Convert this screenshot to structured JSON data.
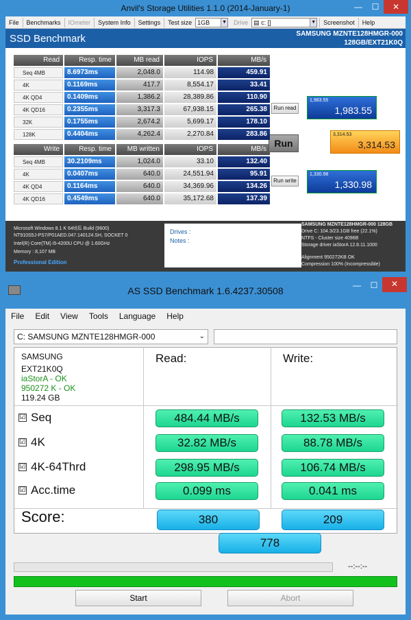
{
  "anvil": {
    "title": "Anvil's Storage Utilities 1.1.0 (2014-January-1)",
    "menu": [
      "File",
      "Benchmarks",
      "IOmeter",
      "System Info",
      "Settings"
    ],
    "testsize_label": "Test size",
    "testsize_value": "1GB",
    "drive_label": "Drive",
    "drive_value": "c: []",
    "screenshot_label": "Screenshot",
    "help_label": "Help",
    "header": "SSD Benchmark",
    "device_line1": "SAMSUNG MZNTE128HMGR-000",
    "device_line2": "128GB/EXT21K0Q",
    "read_headers": [
      "Read",
      "Resp. time",
      "MB read",
      "IOPS",
      "MB/s"
    ],
    "read_rows": [
      {
        "label": "Seq 4MB",
        "resp": "8.6973ms",
        "mb": "2,048.0",
        "iops": "114.98",
        "mbs": "459.91"
      },
      {
        "label": "4K",
        "resp": "0.1169ms",
        "mb": "417.7",
        "iops": "8,554.17",
        "mbs": "33.41"
      },
      {
        "label": "4K QD4",
        "resp": "0.1409ms",
        "mb": "1,386.2",
        "iops": "28,389.86",
        "mbs": "110.90"
      },
      {
        "label": "4K QD16",
        "resp": "0.2355ms",
        "mb": "3,317.3",
        "iops": "67,938.15",
        "mbs": "265.38"
      },
      {
        "label": "32K",
        "resp": "0.1755ms",
        "mb": "2,674.2",
        "iops": "5,699.17",
        "mbs": "178.10"
      },
      {
        "label": "128K",
        "resp": "0.4404ms",
        "mb": "4,262.4",
        "iops": "2,270.84",
        "mbs": "283.86"
      }
    ],
    "write_headers": [
      "Write",
      "Resp. time",
      "MB written",
      "IOPS",
      "MB/s"
    ],
    "write_rows": [
      {
        "label": "Seq 4MB",
        "resp": "30.2109ms",
        "mb": "1,024.0",
        "iops": "33.10",
        "mbs": "132.40"
      },
      {
        "label": "4K",
        "resp": "0.0407ms",
        "mb": "640.0",
        "iops": "24,551.94",
        "mbs": "95.91"
      },
      {
        "label": "4K QD4",
        "resp": "0.1164ms",
        "mb": "640.0",
        "iops": "34,369.96",
        "mbs": "134.26"
      },
      {
        "label": "4K QD16",
        "resp": "0.4549ms",
        "mb": "640.0",
        "iops": "35,172.68",
        "mbs": "137.39"
      }
    ],
    "run_read_label": "Run read",
    "run_label": "Run",
    "run_write_label": "Run write",
    "read_score_small": "1,983.55",
    "read_score": "1,983.55",
    "total_score_small": "3,314.53",
    "total_score": "3,314.53",
    "write_score_small": "1,330.98",
    "write_score": "1,330.98",
    "sys_lines": [
      "Microsoft Windows 8.1 K 64비트 Build (9600)",
      "NT910S5J-PS7/P01AED.047.140124.SH, SOCKET 0",
      "Intel(R) Core(TM) i5-4200U CPU @ 1.60GHz",
      "Memory : 8,107 MB"
    ],
    "edition": "Professional Edition",
    "drives_label": "Drives :",
    "notes_label": "Notes :",
    "drive_info": [
      "SAMSUNG MZNTE128HMGR-000 128GB",
      "Drive C: 104.3/23.1GB free (22.1%)",
      "NTFS - Cluster size 4096B",
      "Storage driver  iaStorA 12.8.11.1000",
      "",
      "Alignment 950272KB OK",
      "Compression 100% (Incompressible)"
    ]
  },
  "asssd": {
    "title": "AS SSD Benchmark 1.6.4237.30508",
    "menu": [
      "File",
      "Edit",
      "View",
      "Tools",
      "Language",
      "Help"
    ],
    "drive": "C: SAMSUNG MZNTE128HMGR-000",
    "info": {
      "model": "SAMSUNG",
      "firmware": "EXT21K0Q",
      "driver": "iaStorA - OK",
      "align": "950272 K - OK",
      "size": "119.24 GB"
    },
    "read_header": "Read:",
    "write_header": "Write:",
    "rows": [
      {
        "label": "Seq",
        "read": "484.44 MB/s",
        "write": "132.53 MB/s"
      },
      {
        "label": "4K",
        "read": "32.82 MB/s",
        "write": "88.78 MB/s"
      },
      {
        "label": "4K-64Thrd",
        "read": "298.95 MB/s",
        "write": "106.74 MB/s"
      },
      {
        "label": "Acc.time",
        "read": "0.099 ms",
        "write": "0.041 ms"
      }
    ],
    "score_label": "Score:",
    "score_read": "380",
    "score_write": "209",
    "score_total": "778",
    "time": "--:--:--",
    "start_label": "Start",
    "abort_label": "Abort",
    "check": "☑"
  }
}
